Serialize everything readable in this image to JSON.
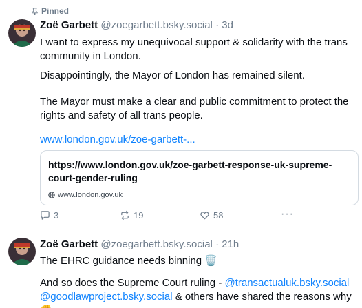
{
  "post1": {
    "pinned_label": "Pinned",
    "author": "Zoë Garbett",
    "handle": "@zoegarbett.bsky.social",
    "separator": "·",
    "time": "3d",
    "paragraphs": [
      "I want to express my unequivocal support & solidarity with the trans community in London.",
      "Disappointingly, the Mayor of London has remained silent.",
      "The Mayor must make a clear and public commitment to protect the rights and safety of all trans people."
    ],
    "link_text": "www.london.gov.uk/zoe-garbett-...",
    "card": {
      "title": "https://www.london.gov.uk/zoe-garbett-response-uk-supreme-court-gender-ruling",
      "domain": "www.london.gov.uk"
    },
    "actions": {
      "replies": "3",
      "reposts": "19",
      "likes": "58",
      "more": "···"
    }
  },
  "post2": {
    "author": "Zoë Garbett",
    "handle": "@zoegarbett.bsky.social",
    "separator": "·",
    "time": "21h",
    "line1": "The EHRC guidance needs binning 🗑️",
    "line2_start": "And so does the Supreme Court ruling - ",
    "mention1": "@transactualuk.bsky.social",
    "mention2": "@goodlawproject.bsky.social",
    "line3_end": " & others have shared the reasons why ✊"
  },
  "colors": {
    "link": "#1083fe",
    "muted": "#6f7d8c",
    "border": "#e2e7ee"
  },
  "icons": [
    "pin-icon",
    "avatar",
    "globe-icon",
    "reply-icon",
    "repost-icon",
    "like-icon",
    "more-icon"
  ]
}
